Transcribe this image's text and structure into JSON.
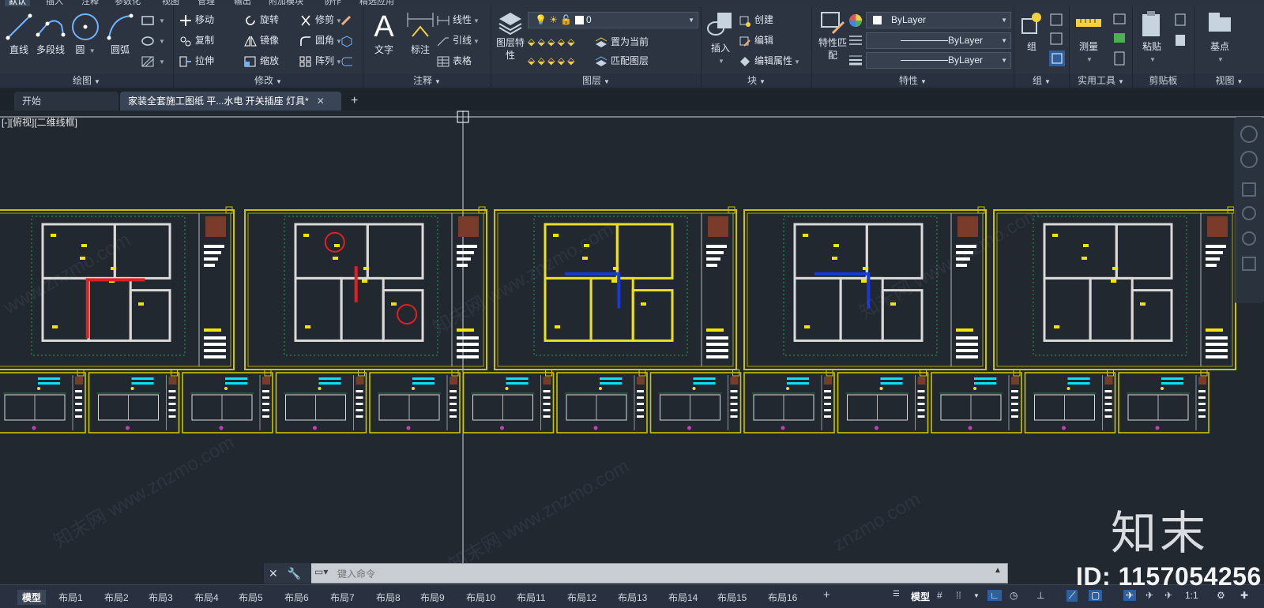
{
  "menu": [
    "默认",
    "插入",
    "注释",
    "参数化",
    "视图",
    "管理",
    "输出",
    "附加模块",
    "协作",
    "精选应用"
  ],
  "panels": {
    "draw": {
      "title": "绘图",
      "buttons": [
        "直线",
        "多段线",
        "圆",
        "圆弧"
      ]
    },
    "modify": {
      "title": "修改",
      "items": [
        "移动",
        "旋转",
        "修剪",
        "复制",
        "镜像",
        "圆角",
        "拉伸",
        "缩放",
        "阵列"
      ]
    },
    "annotation": {
      "title": "注释",
      "big": [
        "文字",
        "标注"
      ],
      "items": [
        "线性",
        "引线",
        "表格"
      ]
    },
    "layers": {
      "title": "图层",
      "big": "图层特性",
      "current_layer": "0",
      "items": [
        "置为当前",
        "匹配图层"
      ]
    },
    "block": {
      "title": "块",
      "big": "插入",
      "items": [
        "创建",
        "编辑",
        "编辑属性"
      ]
    },
    "properties": {
      "title": "特性",
      "big": "特性匹配",
      "color": "ByLayer",
      "linetype": "ByLayer",
      "lineweight": "ByLayer"
    },
    "group": {
      "title": "组",
      "big": "组"
    },
    "utilities": {
      "title": "实用工具",
      "big": "测量"
    },
    "clipboard": {
      "title": "剪贴板",
      "big": "粘贴"
    },
    "view": {
      "title": "视图",
      "big": "基点"
    }
  },
  "tabs": {
    "start": "开始",
    "file": "家装全套施工图纸 平...水电 开关插座 灯具*"
  },
  "viewport": {
    "label": "[-][俯视][二维线框]"
  },
  "watermarks": [
    "www.znzmo.com",
    "知末网 www.znzmo.com",
    "znzmo.com",
    "知末网"
  ],
  "brand": {
    "logo": "知末",
    "id_text": "ID: 1157054256"
  },
  "command": {
    "placeholder": "键入命令"
  },
  "layout_tabs": [
    "模型",
    "布局1",
    "布局2",
    "布局3",
    "布局4",
    "布局5",
    "布局6",
    "布局7",
    "布局8",
    "布局9",
    "布局10",
    "布局11",
    "布局12",
    "布局13",
    "布局14",
    "布局15",
    "布局16"
  ],
  "status": {
    "model": "模型",
    "scale": "1:1"
  },
  "colors": {
    "ribbon": "#2c3442",
    "canvas": "#212830",
    "frame": "#c9c300",
    "cyan": "#00e5ff",
    "red": "#e02020",
    "wall": "#dddddd",
    "accent": "#2e5f9e"
  }
}
